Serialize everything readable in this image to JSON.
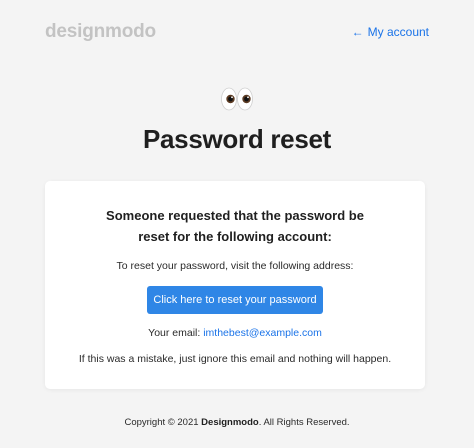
{
  "header": {
    "logo": "designmodo",
    "account_link": {
      "icon": "←",
      "label": "My account"
    }
  },
  "hero": {
    "icon": "eyes-emoji",
    "title": "Password reset"
  },
  "card": {
    "heading_line1": "Someone requested that the password be",
    "heading_line2": "reset for the following account:",
    "instructions": "To reset your password, visit the following address:",
    "button_label": "Click here to reset your password",
    "email_label": "Your email:",
    "email_value": "imthebest@example.com",
    "mistake_note": "If this was a mistake, just ignore this email and nothing will happen."
  },
  "footer": {
    "copyright_prefix": "Copyright © 2021",
    "company": "Designmodo",
    "copyright_suffix": ". All Rights Reserved."
  },
  "colors": {
    "background": "#f4f4f4",
    "accent": "#2f86e6",
    "link": "#1a73e8",
    "logo": "#c3c3c3"
  }
}
